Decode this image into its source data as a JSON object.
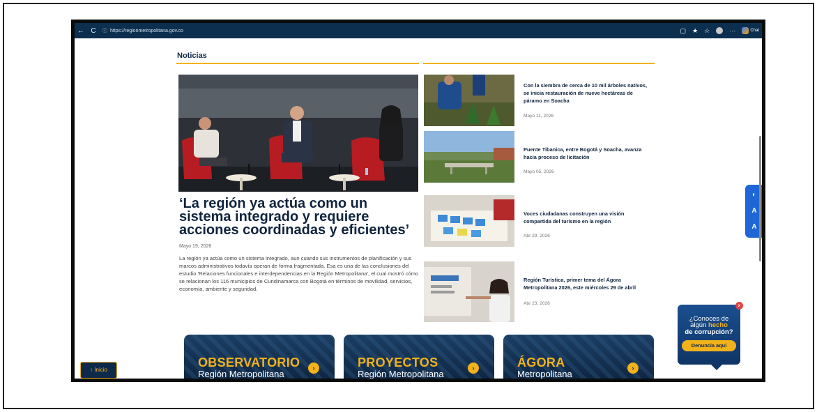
{
  "browser": {
    "url": "https://regionmetropolitana.gov.co",
    "back": "←",
    "reload": "C",
    "chat_label": "Chat"
  },
  "page": {
    "section_title": "Noticias",
    "main_news": {
      "headline": "‘La región ya actúa como un sistema integrado y requiere acciones coordinadas y eficientes’",
      "date": "Mayo 19, 2026",
      "body": "La región ya actúa como un sistema integrado, aun cuando sus instrumentos de planificación y sus marcos administrativos todavía operan de forma fragmentada. Esa es una de las conclusiones del estudio 'Relaciones funcionales e interdependencias en la Región Metropolitana', el cual mostró cómo se relacionan los 116 municipios de Cundinamarca con Bogotá en términos de movilidad, servicios, economía, ambiente y seguridad."
    },
    "news_list": [
      {
        "title": "Con la siembra de cerca de 10 mil árboles nativos, se inicia restauración de nueve hectáreas de páramo en Soacha",
        "date": "Mayo 11, 2026"
      },
      {
        "title": "Puente Tibanica, entre Bogotá y Soacha, avanza hacia proceso de licitación",
        "date": "Mayo 05, 2026"
      },
      {
        "title": "Voces ciudadanas construyen una visión compartida del turismo en la región",
        "date": "Abr 29, 2026"
      },
      {
        "title": "Región Turística, primer tema del Ágora Metropolitana 2026, este miércoles 29 de abril",
        "date": "Abr 23, 2026"
      }
    ],
    "cards": [
      {
        "big": "OBSERVATORIO",
        "small": "Región Metropolitana"
      },
      {
        "big": "PROYECTOS",
        "small": "Región Metropolitana"
      },
      {
        "big": "ÁGORA",
        "small": "Metropolitana"
      }
    ],
    "back_to_top": "↑ Inicio",
    "corruption": {
      "line1": "¿Conoces de",
      "line2_pre": "algún ",
      "line2_bold": "hecho",
      "line3": "de corrupción?",
      "button": "Denuncia aquí"
    }
  },
  "colors": {
    "accent": "#f2b21b",
    "navy": "#0e2a4a",
    "accessibility_blue": "#1f66d6"
  }
}
